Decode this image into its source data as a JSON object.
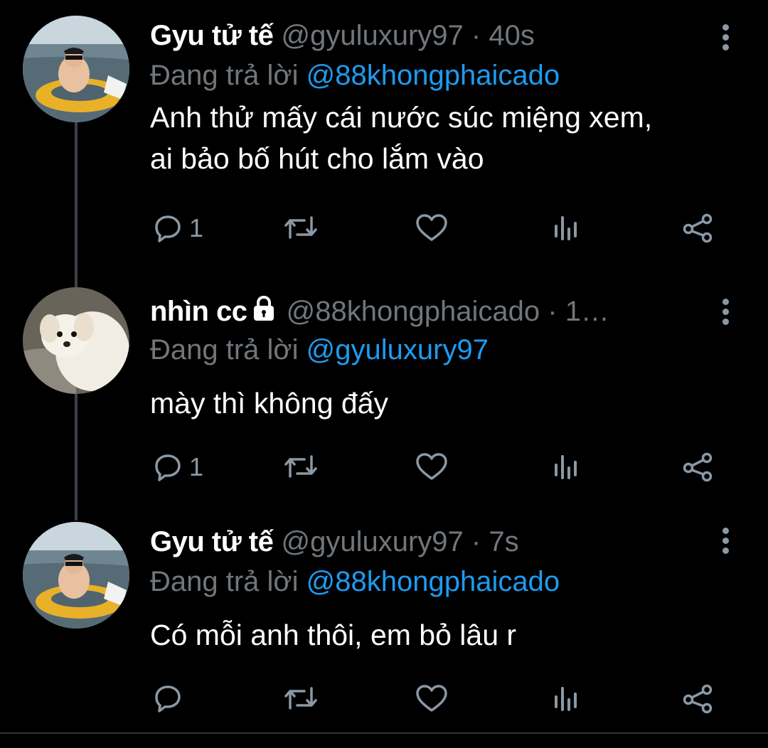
{
  "tweets": [
    {
      "name": "Gyu tử tế",
      "handle": "@gyuluxury97",
      "separator": "·",
      "time": "40s",
      "replying_prefix": "Đang trả lời",
      "replying_to": "@88khongphaicado",
      "text_lines": [
        "Anh thử mấy cái nước súc miệng xem,",
        "ai bảo bố hút cho lắm vào"
      ],
      "reply_count": "1",
      "locked": false,
      "avatar": "man-in-swim-ring-photo"
    },
    {
      "name": "nhìn cc",
      "handle": "@88khongphaicado",
      "separator": "·",
      "time": "1…",
      "replying_prefix": "Đang trả lời",
      "replying_to": "@gyuluxury97",
      "text_lines": [
        "mày thì không đấy"
      ],
      "reply_count": "1",
      "locked": true,
      "avatar": "white-dog-photo"
    },
    {
      "name": "Gyu tử tế",
      "handle": "@gyuluxury97",
      "separator": "·",
      "time": "7s",
      "replying_prefix": "Đang trả lời",
      "replying_to": "@88khongphaicado",
      "text_lines": [
        "Có mỗi anh thôi, em bỏ lâu r"
      ],
      "reply_count": "",
      "locked": false,
      "avatar": "man-in-swim-ring-photo"
    }
  ],
  "icons": {
    "reply": "reply-icon",
    "retweet": "retweet-icon",
    "like": "heart-icon",
    "analytics": "analytics-icon",
    "share": "share-icon",
    "more": "more-vertical-icon",
    "lock": "lock-icon"
  },
  "colors": {
    "background": "#000000",
    "text": "#ffffff",
    "secondary": "#71767b",
    "accent": "#1d9bf0",
    "thread_line": "#3a4149"
  }
}
